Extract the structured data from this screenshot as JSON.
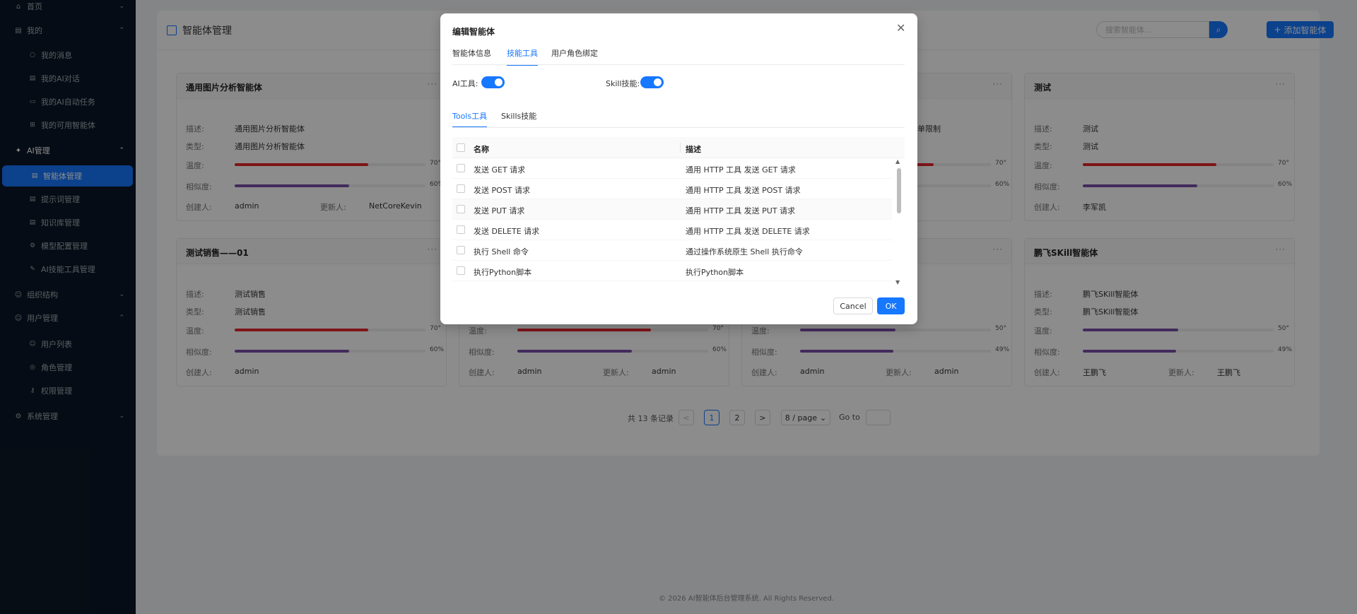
{
  "sidebar": {
    "items": [
      {
        "label": "首页",
        "icon": "home-icon"
      },
      {
        "label": "我的",
        "icon": "document-icon"
      },
      {
        "label": "我的消息",
        "icon": "message-icon"
      },
      {
        "label": "我的AI对话",
        "icon": "chat-icon"
      },
      {
        "label": "我的AI自动任务",
        "icon": "task-icon"
      },
      {
        "label": "我的可用智能体",
        "icon": "grid-icon"
      },
      {
        "label": "AI管理",
        "icon": "ai-icon"
      },
      {
        "label": "智能体管理",
        "icon": "agent-icon"
      },
      {
        "label": "提示词管理",
        "icon": "prompt-icon"
      },
      {
        "label": "知识库管理",
        "icon": "knowledge-icon"
      },
      {
        "label": "模型配置管理",
        "icon": "model-icon"
      },
      {
        "label": "AI技能工具管理",
        "icon": "tool-icon"
      },
      {
        "label": "组织结构",
        "icon": "org-icon"
      },
      {
        "label": "用户管理",
        "icon": "user-icon"
      },
      {
        "label": "用户列表",
        "icon": "user-list-icon"
      },
      {
        "label": "角色管理",
        "icon": "role-icon"
      },
      {
        "label": "权限管理",
        "icon": "permission-icon"
      },
      {
        "label": "系统管理",
        "icon": "gear-icon"
      }
    ]
  },
  "page": {
    "title": "智能体管理",
    "search_placeholder": "搜索智能体...",
    "add_label": "添加智能体",
    "add_plus": "+"
  },
  "labels": {
    "desc": "描述:",
    "type": "类型:",
    "temperature": "温度:",
    "similarity": "相似度:",
    "creator": "创建人:",
    "updater": "更新人:",
    "more": "···"
  },
  "cards": [
    {
      "title": "通用图片分析智能体",
      "desc": "通用图片分析智能体",
      "type": "通用图片分析智能体",
      "temperature": 0.7,
      "temp_label": "70°",
      "similarity": 0.6,
      "sim_label": "60%",
      "creator": "admin",
      "updater": "NetCoreKevin"
    },
    {
      "title": "测试",
      "desc": "测试",
      "type": "测试",
      "temperature": 0.7,
      "temp_label": "70°",
      "similarity": 0.6,
      "sim_label": "60%",
      "creator": "李军凯",
      "updater": ""
    },
    {
      "title": "测试销售——01",
      "desc": "测试销售",
      "type": "测试销售",
      "temperature": 0.7,
      "temp_label": "70°",
      "similarity": 0.6,
      "sim_label": "60%",
      "creator": "admin",
      "updater": ""
    },
    {
      "title": "",
      "desc": "",
      "type": "",
      "temperature": 0.7,
      "temp_label": "70°",
      "similarity": 0.6,
      "sim_label": "60%",
      "creator": "admin",
      "updater": "admin"
    },
    {
      "title": "",
      "desc": "",
      "type": "",
      "temperature": 0.5,
      "temp_label": "50°",
      "similarity": 0.49,
      "sim_label": "49%",
      "creator": "admin",
      "updater": "admin"
    },
    {
      "title": "鹏飞SKill智能体",
      "desc": "鹏飞SKill智能体",
      "type": "鹏飞SKill智能体",
      "temperature": 0.5,
      "temp_label": "50°",
      "similarity": 0.49,
      "sim_label": "49%",
      "creator": "王鹏飞",
      "updater": "王鹏飞"
    }
  ],
  "partial": {
    "text": "单限制",
    "temp_label": "70°",
    "sim_label": "60%"
  },
  "pagination": {
    "total_text": "共 13 条记录",
    "prev": "<",
    "next": ">",
    "pages": [
      "1",
      "2"
    ],
    "page_size": "8 / page",
    "goto": "Go to"
  },
  "footer": "© 2026 AI智能体后台管理系统. All Rights Reserved.",
  "modal": {
    "title": "编辑智能体",
    "close": "✕",
    "tabs": [
      "智能体信息",
      "技能工具",
      "用户角色绑定"
    ],
    "ai_tools_label": "AI工具:",
    "skill_label": "Skill技能:",
    "subtabs": [
      "Tools工具",
      "Skills技能"
    ],
    "columns": [
      "名称",
      "描述"
    ],
    "rows": [
      {
        "name": "发送 GET 请求",
        "desc": "通用 HTTP 工具 发送 GET 请求"
      },
      {
        "name": "发送 POST 请求",
        "desc": "通用 HTTP 工具 发送 POST 请求"
      },
      {
        "name": "发送 PUT 请求",
        "desc": "通用 HTTP 工具 发送 PUT 请求"
      },
      {
        "name": "发送 DELETE 请求",
        "desc": "通用 HTTP 工具 发送 DELETE 请求"
      },
      {
        "name": "执行 Shell 命令",
        "desc": "通过操作系统原生 Shell 执行命令"
      },
      {
        "name": "执行Python脚本",
        "desc": "执行Python脚本"
      }
    ],
    "cancel": "Cancel",
    "ok": "OK"
  },
  "colors": {
    "primary": "#1677ff",
    "sidebar_bg": "#0b1727",
    "temp_bar": "#e6252c",
    "sim_bar": "#7b4fa8"
  }
}
